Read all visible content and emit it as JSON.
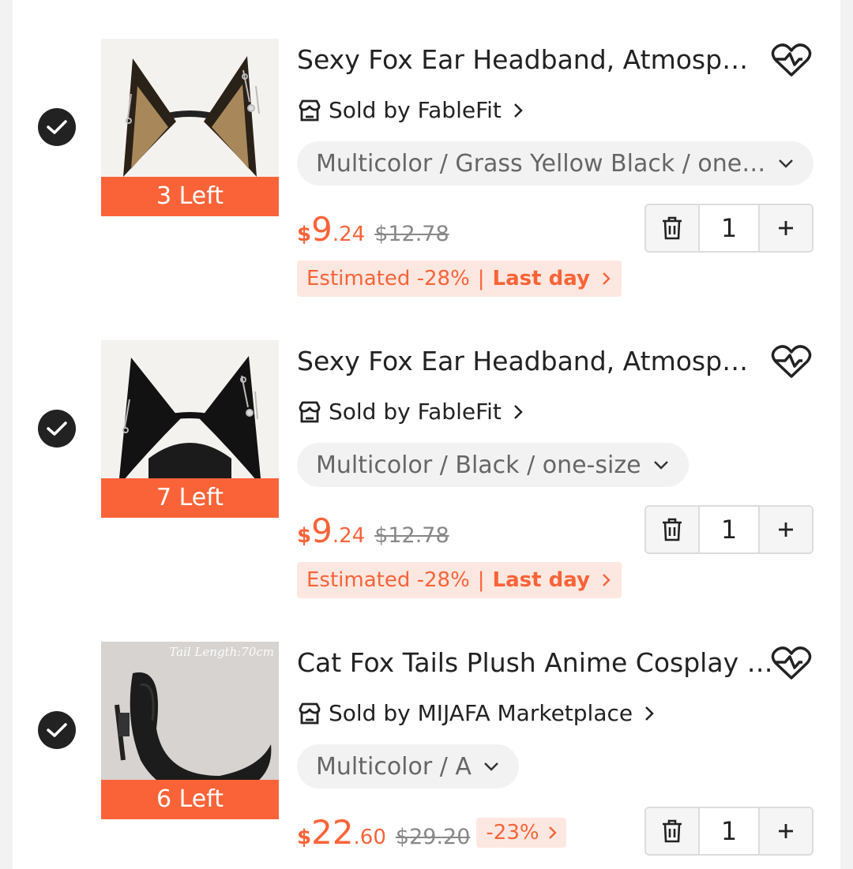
{
  "items": [
    {
      "selected": true,
      "stock_label": "3 Left",
      "title": "Sexy Fox Ear Headband, Atmospheric Furry Animal Ears",
      "seller": "Sold by FableFit",
      "variant": "Multicolor / Grass Yellow Black / one-size",
      "price_currency": "$",
      "price_int": "9",
      "price_dec": ".24",
      "original_price": "$12.78",
      "promo_estimated": "Estimated -28%",
      "promo_separator": "|",
      "promo_deadline": "Last day",
      "quantity": "1",
      "fur_color": "#a8885a"
    },
    {
      "selected": true,
      "stock_label": "7 Left",
      "title": "Sexy Fox Ear Headband, Atmospheric Furry Animal Ears",
      "seller": "Sold by FableFit",
      "variant": "Multicolor / Black / one-size",
      "price_currency": "$",
      "price_int": "9",
      "price_dec": ".24",
      "original_price": "$12.78",
      "promo_estimated": "Estimated -28%",
      "promo_separator": "|",
      "promo_deadline": "Last day",
      "quantity": "1",
      "fur_color": "#1a1a1a"
    },
    {
      "selected": true,
      "stock_label": "6 Left",
      "image_caption": "Tail Length:70cm",
      "title": "Cat Fox Tails Plush Anime Cosplay Bikini Accessory",
      "seller": "Sold by MIJAFA Marketplace",
      "variant": "Multicolor / A",
      "price_currency": "$",
      "price_int": "22",
      "price_dec": ".60",
      "original_price": "$29.20",
      "discount_tag": "-23%",
      "quantity": "1",
      "fur_color": "#1c1c1c"
    }
  ],
  "colors": {
    "accent": "#fa6338",
    "promo_bg": "#fde8e1",
    "check_bg": "#222222"
  },
  "icons": {
    "check": "check-icon",
    "wishlist": "heart-wishlist-icon",
    "store": "store-icon",
    "delete": "trash-icon",
    "add": "plus-icon",
    "dropdown": "chevron-down-icon"
  }
}
